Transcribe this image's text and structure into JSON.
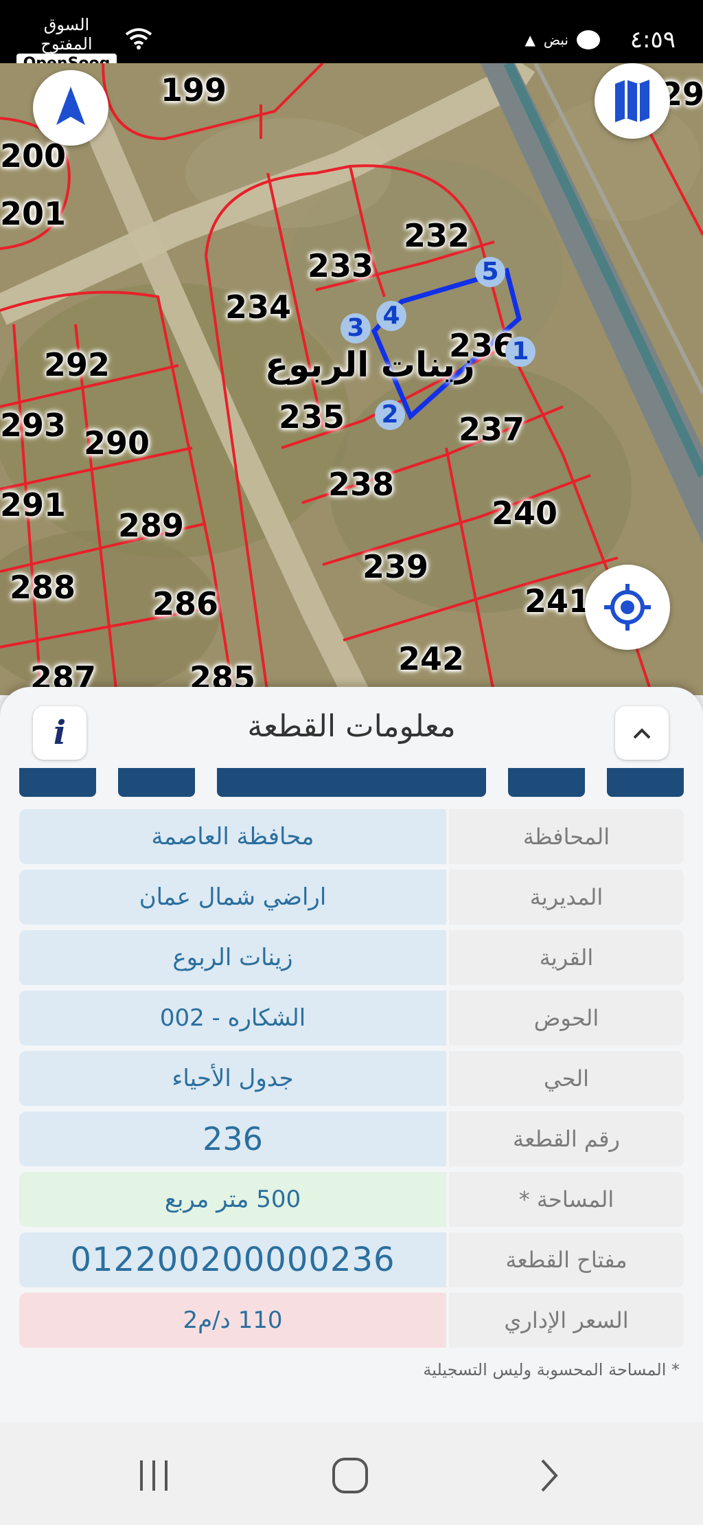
{
  "status_bar": {
    "time": "٤:٥٩",
    "pulse_label": "نبض",
    "app_name_ar": "السوق المفتوح",
    "app_name_en": "OpenSooq"
  },
  "map": {
    "village_label": "زينات الربوع",
    "parcels": [
      {
        "id": "p199",
        "label": "199"
      },
      {
        "id": "p200",
        "label": "200"
      },
      {
        "id": "p201",
        "label": "201"
      },
      {
        "id": "p232",
        "label": "232"
      },
      {
        "id": "p233",
        "label": "233"
      },
      {
        "id": "p234",
        "label": "234"
      },
      {
        "id": "p236",
        "label": "236"
      },
      {
        "id": "p235",
        "label": "235"
      },
      {
        "id": "p237",
        "label": "237"
      },
      {
        "id": "p292",
        "label": "292"
      },
      {
        "id": "p293",
        "label": "293"
      },
      {
        "id": "p290",
        "label": "290"
      },
      {
        "id": "p238",
        "label": "238"
      },
      {
        "id": "p240",
        "label": "240"
      },
      {
        "id": "p291",
        "label": "291"
      },
      {
        "id": "p289",
        "label": "289"
      },
      {
        "id": "p239",
        "label": "239"
      },
      {
        "id": "p288",
        "label": "288"
      },
      {
        "id": "p286",
        "label": "286"
      },
      {
        "id": "p241",
        "label": "241"
      },
      {
        "id": "p242",
        "label": "242"
      },
      {
        "id": "p287",
        "label": "287"
      },
      {
        "id": "p285",
        "label": "285"
      },
      {
        "id": "p29",
        "label": "29"
      }
    ],
    "vertices": [
      "1",
      "2",
      "3",
      "4",
      "5"
    ],
    "compass_icon": "navigation-arrow-icon",
    "layers_icon": "map-layers-icon",
    "locate_icon": "my-location-icon"
  },
  "sheet": {
    "title": "معلومات القطعة",
    "info_icon_label": "i",
    "rows": [
      {
        "label": "المحافظة",
        "value": "محافظة العاصمة"
      },
      {
        "label": "المديرية",
        "value": "اراضي شمال عمان"
      },
      {
        "label": "القرية",
        "value": "زينات الربوع"
      },
      {
        "label": "الحوض",
        "value": "الشكاره - 002"
      },
      {
        "label": "الحي",
        "value": "جدول الأحياء"
      },
      {
        "label": "رقم القطعة",
        "value": "236"
      },
      {
        "label": "المساحة *",
        "value": "500  متر مربع"
      },
      {
        "label": "مفتاح القطعة",
        "value": "012200200000236"
      },
      {
        "label": "السعر الإداري",
        "value": "110 د/م2"
      }
    ],
    "note": "* المساحة المحسوبة وليس التسجيلية"
  },
  "colors": {
    "parcel_border": "#e8202a",
    "selected_parcel": "#1230e8",
    "toolbar_button": "#1d4c7a",
    "value_blue": "#2a6f9e"
  }
}
